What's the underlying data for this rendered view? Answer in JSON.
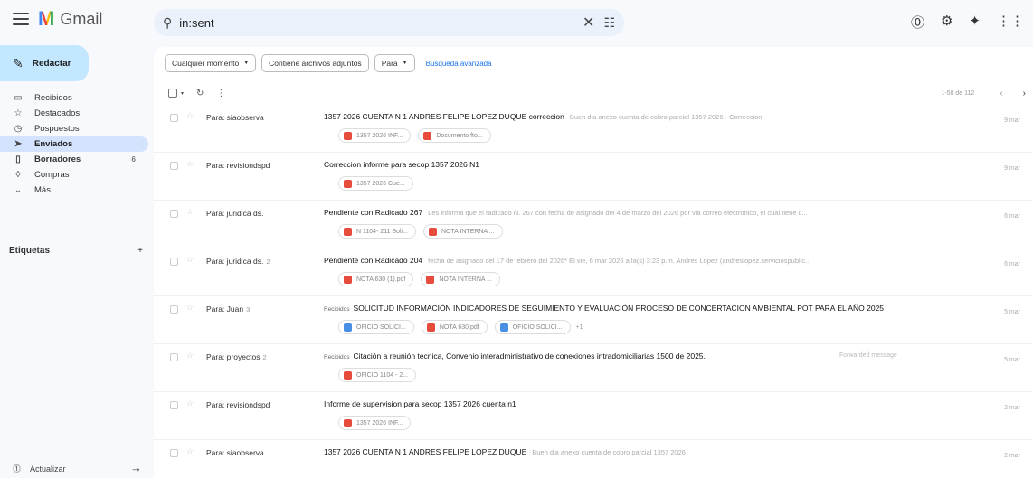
{
  "app": {
    "name": "Gmail",
    "logo_letter": "M"
  },
  "search": {
    "query": "in:sent"
  },
  "sidebar": {
    "compose_label": "Redactar",
    "items": [
      {
        "label": "Recibidos",
        "icon": "inbox-icon",
        "glyph": "▭",
        "active": false,
        "bold": false,
        "count": ""
      },
      {
        "label": "Destacados",
        "icon": "star-icon",
        "glyph": "☆",
        "active": false,
        "bold": false,
        "count": ""
      },
      {
        "label": "Pospuestos",
        "icon": "clock-icon",
        "glyph": "◷",
        "active": false,
        "bold": false,
        "count": ""
      },
      {
        "label": "Enviados",
        "icon": "send-icon",
        "glyph": "➤",
        "active": true,
        "bold": true,
        "count": ""
      },
      {
        "label": "Borradores",
        "icon": "draft-icon",
        "glyph": "▯",
        "active": false,
        "bold": true,
        "count": "6"
      },
      {
        "label": "Compras",
        "icon": "shopping-icon",
        "glyph": "◊",
        "active": false,
        "bold": false,
        "count": ""
      },
      {
        "label": "Más",
        "icon": "chevron-down-icon",
        "glyph": "⌄",
        "active": false,
        "bold": false,
        "count": ""
      }
    ],
    "labels_heading": "Etiquetas",
    "refresh_label": "Actualizar"
  },
  "filters": {
    "chips": [
      {
        "label": "Cualquier momento",
        "dropdown": true
      },
      {
        "label": "Contiene archivos adjuntos",
        "dropdown": false
      },
      {
        "label": "Para",
        "dropdown": true
      }
    ],
    "advanced": "Busqueda avanzada"
  },
  "toolbar": {
    "pager": "1-50 de 112"
  },
  "emails": [
    {
      "to": "Para: siaobserva",
      "count": "",
      "tag": "",
      "subject": "1357 2026 CUENTA N 1 ANDRES FELIPE LOPEZ DUQUE correccion",
      "snippet": "Buen dia anexo cuenta de cobro parcial 1357 2026 · Correccion",
      "extra": "",
      "date": "9 mar",
      "attachments": [
        {
          "name": "1357 2026 INF...",
          "type": "pdf"
        },
        {
          "name": "Documento fto...",
          "type": "pdf"
        }
      ],
      "more": ""
    },
    {
      "to": "Para: revisiondspd",
      "count": "",
      "tag": "",
      "subject": "Correccion informe para secop 1357 2026 N1",
      "snippet": "",
      "extra": "",
      "date": "9 mar",
      "attachments": [
        {
          "name": "1357 2026 Cue...",
          "type": "pdf"
        }
      ],
      "more": ""
    },
    {
      "to": "Para: juridica ds.",
      "count": "",
      "tag": "",
      "subject": "Pendiente con Radicado 267",
      "snippet": "Les informa que el radicado N. 267 con fecha de asignado del 4 de marzo del 2026 por via correo electronico, el cual tiene c...",
      "extra": "",
      "date": "6 mar",
      "attachments": [
        {
          "name": "N 1104- 211 Soli...",
          "type": "pdf"
        },
        {
          "name": "NOTA INTERNA ...",
          "type": "pdf"
        }
      ],
      "more": ""
    },
    {
      "to": "Para: juridica ds.",
      "count": "2",
      "tag": "",
      "subject": "Pendiente con Radicado 204",
      "snippet": "fecha de asignado del 17 de febrero del 2026* El vie, 6 mar 2026 a la(s) 3:23 p.m. Andres Lopez (andreslopez.serviciospublic...",
      "extra": "",
      "date": "6 mar",
      "attachments": [
        {
          "name": "NOTA 630 (1).pdf",
          "type": "pdf"
        },
        {
          "name": "NOTA INTERNA ...",
          "type": "pdf"
        }
      ],
      "more": ""
    },
    {
      "to": "Para: Juan",
      "count": "3",
      "tag": "Recibidos",
      "subject": "SOLICITUD INFORMACIÓN INDICADORES DE SEGUIMIENTO Y EVALUACIÓN PROCESO DE CONCERTACION AMBIENTAL POT PARA EL AÑO 2025",
      "snippet": "",
      "extra": "",
      "date": "5 mar",
      "attachments": [
        {
          "name": "OFICIO SOLICI...",
          "type": "doc"
        },
        {
          "name": "NOTA 630.pdf",
          "type": "pdf"
        },
        {
          "name": "OFICIO SOLICI...",
          "type": "doc"
        }
      ],
      "more": "+1"
    },
    {
      "to": "Para: proyectos",
      "count": "2",
      "tag": "Recibidos",
      "subject": "Citación a reunión tecnica, Convenio interadministrativo de conexiones intradomiciliarias 1500 de 2025.",
      "snippet": "",
      "extra": "Forwarded message",
      "date": "5 mar",
      "attachments": [
        {
          "name": "OFICIO 1104 - 2...",
          "type": "pdf"
        }
      ],
      "more": ""
    },
    {
      "to": "Para: revisiondspd",
      "count": "",
      "tag": "",
      "subject": "Informe de supervision para secop 1357 2026 cuenta n1",
      "snippet": "",
      "extra": "",
      "date": "2 mar",
      "attachments": [
        {
          "name": "1357 2026 INF...",
          "type": "pdf"
        }
      ],
      "more": ""
    },
    {
      "to": "Para: siaobserva ...",
      "count": "",
      "tag": "",
      "subject": "1357 2026 CUENTA N 1 ANDRES FELIPE LOPEZ DUQUE",
      "snippet": "Buen dia anexo cuenta de cobro parcial 1357 2026",
      "extra": "",
      "date": "2 mar",
      "attachments": [],
      "more": ""
    }
  ]
}
